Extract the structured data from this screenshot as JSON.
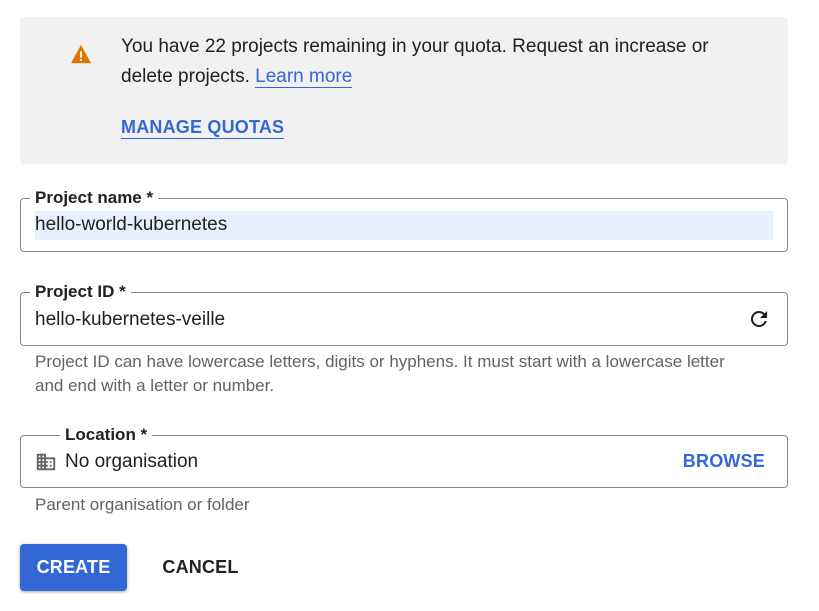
{
  "banner": {
    "message": "You have 22 projects remaining in your quota. Request an increase or delete projects.",
    "learn_more": "Learn more",
    "manage_quotas": "MANAGE QUOTAS",
    "icon": "warning-icon",
    "icon_color": "#e37400"
  },
  "project_name": {
    "label": "Project name *",
    "value": "hello-world-kubernetes"
  },
  "project_id": {
    "label": "Project ID *",
    "value": "hello-kubernetes-veille",
    "hint": "Project ID can have lowercase letters, digits or hyphens. It must start with a lowercase letter and end with a letter or number.",
    "icon": "refresh-icon"
  },
  "location": {
    "label": "Location *",
    "value": "No organisation",
    "browse": "BROWSE",
    "hint": "Parent organisation or folder",
    "icon": "building-icon"
  },
  "actions": {
    "create": "CREATE",
    "cancel": "CANCEL"
  },
  "colors": {
    "accent": "#3367d6",
    "banner_bg": "#f1f1f1",
    "field_highlight": "#e8f0fe"
  }
}
